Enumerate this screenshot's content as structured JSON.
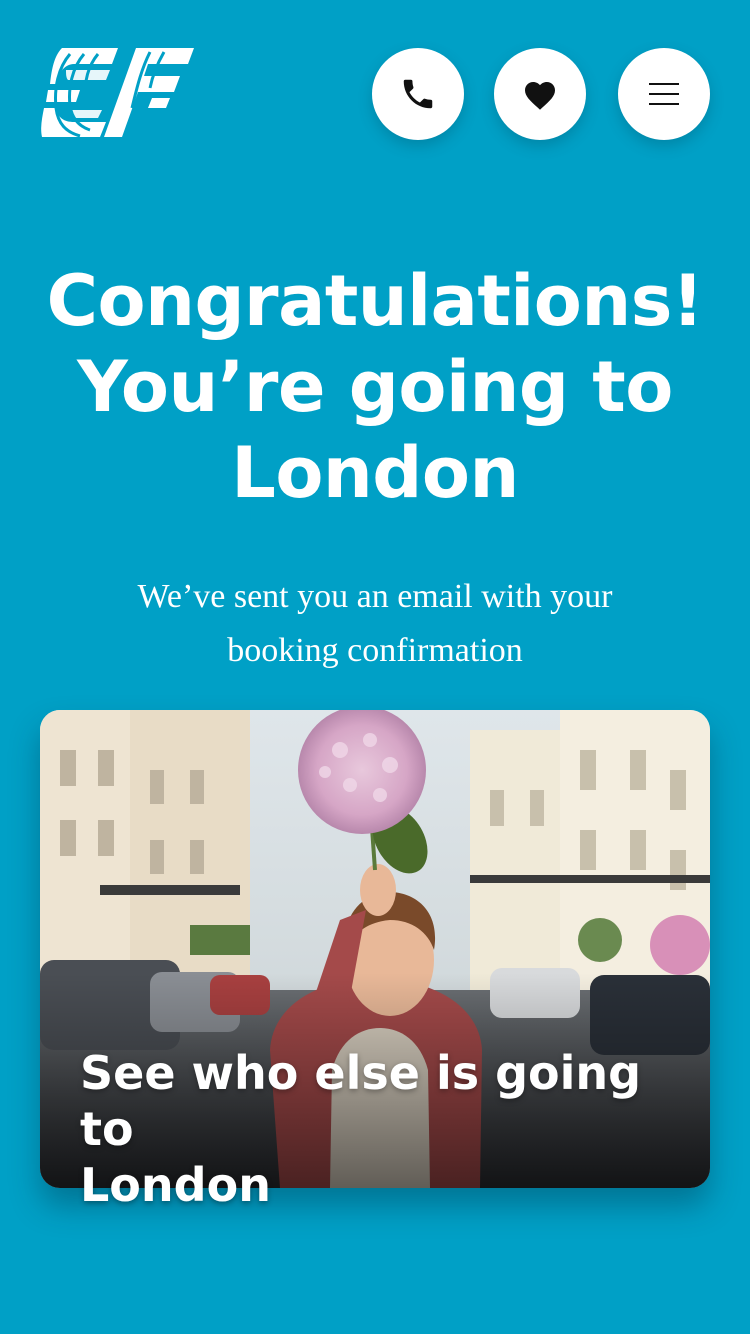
{
  "brand": {
    "logo_icon": "ef-logo",
    "background_color": "#00A0C6"
  },
  "nav": {
    "phone_icon": "phone-icon",
    "heart_icon": "heart-icon",
    "menu_icon": "hamburger-menu-icon"
  },
  "hero": {
    "title_line1": "Congratulations!",
    "title_line2": "You’re going to",
    "title_line3": "London",
    "subtitle_line1": "We’ve sent you an email with your",
    "subtitle_line2": "booking confirmation"
  },
  "card": {
    "title_line1": "See who else is going to",
    "title_line2": "London"
  }
}
